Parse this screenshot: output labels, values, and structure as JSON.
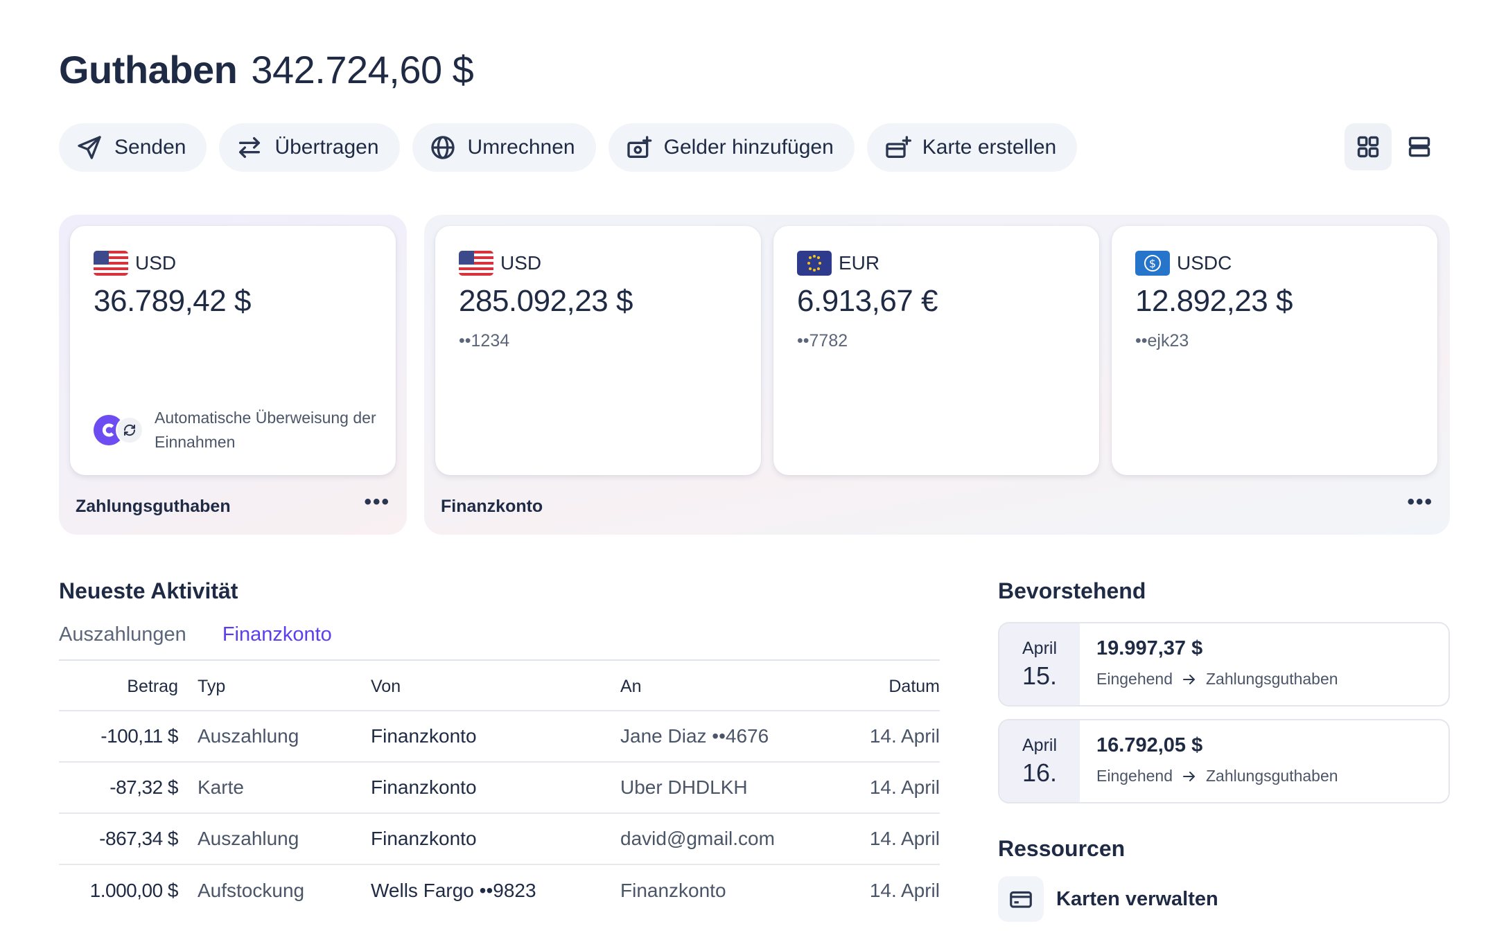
{
  "header": {
    "title": "Guthaben",
    "total": "342.724,60 $"
  },
  "actions": [
    {
      "label": "Senden",
      "icon": "send-icon"
    },
    {
      "label": "Übertragen",
      "icon": "transfer-icon"
    },
    {
      "label": "Umrechnen",
      "icon": "globe-icon"
    },
    {
      "label": "Gelder hinzufügen",
      "icon": "add-funds-icon"
    },
    {
      "label": "Karte erstellen",
      "icon": "create-card-icon"
    }
  ],
  "view_toggle": {
    "active": "grid"
  },
  "payment_group": {
    "label": "Zahlungsguthaben",
    "card": {
      "currency": "USD",
      "amount": "36.789,42 $",
      "auto_text": "Automatische Überweisung der Einnahmen"
    }
  },
  "finance_group": {
    "label": "Finanzkonto",
    "cards": [
      {
        "currency": "USD",
        "amount": "285.092,23 $",
        "account": "••1234"
      },
      {
        "currency": "EUR",
        "amount": "6.913,67 €",
        "account": "••7782"
      },
      {
        "currency": "USDC",
        "amount": "12.892,23 $",
        "account": "••ejk23"
      }
    ]
  },
  "activity": {
    "title": "Neueste Aktivität",
    "tabs": [
      {
        "label": "Auszahlungen",
        "active": false
      },
      {
        "label": "Finanzkonto",
        "active": true
      }
    ],
    "columns": {
      "amount": "Betrag",
      "type": "Typ",
      "from": "Von",
      "to": "An",
      "date": "Datum"
    },
    "rows": [
      {
        "amount": "-100,11 $",
        "type": "Auszahlung",
        "from": "Finanzkonto",
        "to": "Jane Diaz ••4676",
        "date": "14. April"
      },
      {
        "amount": "-87,32 $",
        "type": "Karte",
        "from": "Finanzkonto",
        "to": "Uber DHDLKH",
        "date": "14. April"
      },
      {
        "amount": "-867,34 $",
        "type": "Auszahlung",
        "from": "Finanzkonto",
        "to": "david@gmail.com",
        "date": "14. April"
      },
      {
        "amount": "1.000,00 $",
        "type": "Aufstockung",
        "from": "Wells Fargo ••9823",
        "to": "Finanzkonto",
        "date": "14. April"
      }
    ]
  },
  "upcoming": {
    "title": "Bevorstehend",
    "items": [
      {
        "month": "April",
        "day": "15.",
        "amount": "19.997,37 $",
        "direction": "Eingehend",
        "target": "Zahlungsguthaben"
      },
      {
        "month": "April",
        "day": "16.",
        "amount": "16.792,05 $",
        "direction": "Eingehend",
        "target": "Zahlungsguthaben"
      }
    ]
  },
  "resources": {
    "title": "Ressourcen",
    "items": [
      {
        "label": "Karten verwalten",
        "icon": "card-icon"
      }
    ]
  },
  "colors": {
    "text": "#1f2a44",
    "muted": "#5b667a",
    "accent": "#5b3ef0",
    "chip": "#f1f4f8"
  }
}
